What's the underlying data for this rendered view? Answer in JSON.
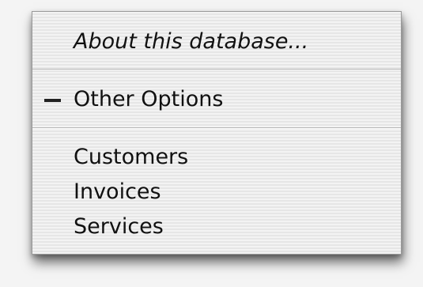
{
  "menu": {
    "items": [
      {
        "label": "About this database..."
      },
      {
        "label": "Other Options",
        "marker": "dash-icon"
      },
      {
        "label": "Customers"
      },
      {
        "label": "Invoices"
      },
      {
        "label": "Services"
      }
    ]
  }
}
